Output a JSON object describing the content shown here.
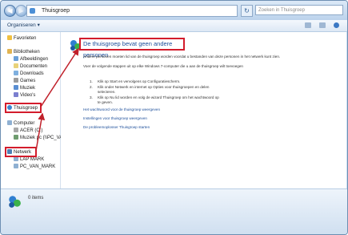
{
  "window": {
    "address": "Thuisgroep",
    "search_placeholder": "Zoeken in Thuisgroep"
  },
  "toolbar": {
    "organize_label": "Organiseren"
  },
  "sidebar": {
    "favorites": "Favorieten",
    "libraries": "Bibliotheken",
    "library_items": [
      "Afbeeldingen",
      "Documenten",
      "Downloads",
      "Games",
      "Muziek",
      "Video's"
    ],
    "homegroup": "Thuisgroep",
    "computer": "Computer",
    "computer_items": [
      "ACER (C:)",
      "Muziek pc (\\\\PC_VA"
    ],
    "network": "Netwerk",
    "network_items": [
      "LAP MARK",
      "PC_VAN_MARK"
    ]
  },
  "main": {
    "heading": "De thuisgroep bevat geen andere personen",
    "intro": "Andere personen moeten lid van de thuisgroep worden voordat u bestanden van deze personen in het netwerk kunt zien.",
    "steps_intro": "Voer de volgende stappen uit op elke Windows 7-computer die u aan de thuisgroep wilt toevoegen",
    "steps": [
      {
        "num": "1.",
        "text": "Klik op Start en vervolgens op Configuratiescherm."
      },
      {
        "num": "2.",
        "text": "Klik onder Netwerk en internet op Opties voor thuisgroepen en delen",
        "text2": "selecteren."
      },
      {
        "num": "3.",
        "text": "Klik op Nu lid worden en volg de wizard Thuisgroep om het wachtwoord op",
        "text2": "te geven."
      }
    ],
    "links": [
      "Het wachtwoord voor de thuisgroep weergeven",
      "Instellingen voor thuisgroep weergeven",
      "De probleemoplosser Thuisgroep starten"
    ]
  },
  "status": {
    "items": "0 items"
  }
}
